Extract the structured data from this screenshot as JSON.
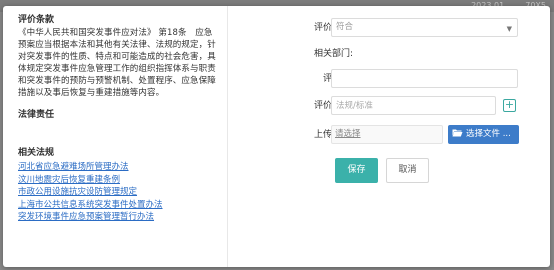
{
  "backdrop": {
    "text": "2023.01 …… 70X5"
  },
  "left": {
    "clause_heading": "评价条款",
    "clause_text": "《中华人民共和国突发事件应对法》 第18条　应急预案应当根据本法和其他有关法律、法规的规定，针对突发事件的性质、特点和可能造成的社会危害，具体规定突发事件应急管理工作的组织指挥体系与职责和突发事件的预防与预警机制、处置程序、应急保障措施以及事后恢复与重建措施等内容。",
    "law_heading": "法律责任",
    "regs_heading": "相关法规",
    "regs": [
      "河北省应急避难场所管理办法",
      "汶川地震灾后恢复重建条例",
      "市政公用设施抗灾设防管理规定",
      "上海市公共信息系统突发事件处置办法",
      "突发环境事件应急预案管理暂行办法"
    ]
  },
  "form": {
    "result_label": "评价结果:",
    "result_value": "符合",
    "dept_label": "相关部门:",
    "evaluator_label": "评价人:",
    "evidence_label": "评价证据:",
    "evidence_placeholder": "法规/标准",
    "plus": "+",
    "upload_label": "上传证据:",
    "upload_link": "请选择",
    "choose_file": "选择文件 ..."
  },
  "buttons": {
    "save": "保存",
    "cancel": "取消"
  },
  "colors": {
    "primary": "#3bb1aa",
    "file_button": "#3d7cc9",
    "link": "#2b6cc4"
  }
}
